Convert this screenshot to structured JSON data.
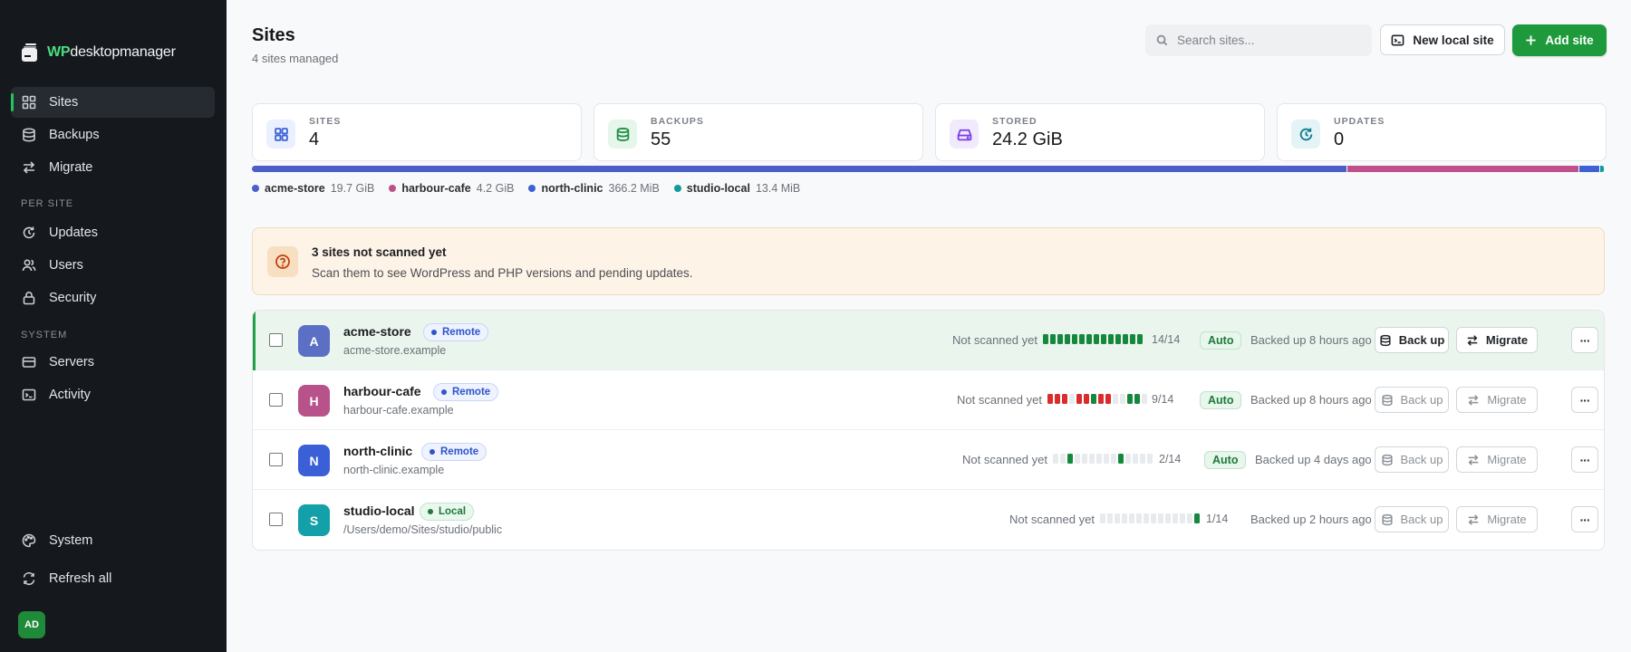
{
  "brand": {
    "prefix": "WP",
    "name": "desktopmanager"
  },
  "sidebar": {
    "items": [
      {
        "label": "Sites",
        "icon": "grid-icon"
      },
      {
        "label": "Backups",
        "icon": "database-icon"
      },
      {
        "label": "Migrate",
        "icon": "arrows-icon"
      }
    ],
    "per_site_label": "PER SITE",
    "per_site": [
      {
        "label": "Updates",
        "icon": "refresh-icon"
      },
      {
        "label": "Users",
        "icon": "users-icon"
      },
      {
        "label": "Security",
        "icon": "lock-icon"
      }
    ],
    "system_label": "SYSTEM",
    "system": [
      {
        "label": "Servers",
        "icon": "server-icon"
      },
      {
        "label": "Activity",
        "icon": "terminal-icon"
      }
    ],
    "footer": [
      {
        "label": "System",
        "icon": "palette-icon"
      },
      {
        "label": "Refresh all",
        "icon": "refresh-icon"
      }
    ],
    "avatar": "AD"
  },
  "header": {
    "title": "Sites",
    "subtitle": "4 sites managed",
    "search_placeholder": "Search sites...",
    "new_local_label": "New local site",
    "add_site_label": "Add site"
  },
  "stats": [
    {
      "label": "SITES",
      "value": "4"
    },
    {
      "label": "BACKUPS",
      "value": "55"
    },
    {
      "label": "STORED",
      "value": "24.2 GiB"
    },
    {
      "label": "UPDATES",
      "value": "0"
    }
  ],
  "storage": [
    {
      "name": "acme-store",
      "size": "19.7 GiB",
      "color": "#4a5fc8",
      "fraction": 0.814
    },
    {
      "name": "harbour-cafe",
      "size": "4.2 GiB",
      "color": "#c0508a",
      "fraction": 0.171
    },
    {
      "name": "north-clinic",
      "size": "366.2 MiB",
      "color": "#3d62d6",
      "fraction": 0.015
    },
    {
      "name": "studio-local",
      "size": "13.4 MiB",
      "color": "#139b9b",
      "fraction": 0.0005
    }
  ],
  "alert": {
    "title": "3 sites not scanned yet",
    "text": "Scan them to see WordPress and PHP versions and pending updates."
  },
  "sites": [
    {
      "name": "acme-store",
      "domain": "acme-store.example",
      "badge": "Remote",
      "initial": "A",
      "color": "#5b6fc4",
      "scan": "Not scanned yet",
      "count": "14/14",
      "auto": "Auto",
      "backed": "Backed up 8 hours ago",
      "backup_label": "Back up",
      "migrate_label": "Migrate",
      "more_label": "···"
    },
    {
      "name": "harbour-cafe",
      "domain": "harbour-cafe.example",
      "badge": "Remote",
      "initial": "H",
      "color": "#b8528a",
      "scan": "Not scanned yet",
      "count": "9/14",
      "auto": "Auto",
      "backed": "Backed up 8 hours ago",
      "backup_label": "Back up",
      "migrate_label": "Migrate",
      "more_label": "···"
    },
    {
      "name": "north-clinic",
      "domain": "north-clinic.example",
      "badge": "Remote",
      "initial": "N",
      "color": "#3b5fd6",
      "scan": "Not scanned yet",
      "count": "2/14",
      "auto": "Auto",
      "backed": "Backed up 4 days ago",
      "backup_label": "Back up",
      "migrate_label": "Migrate",
      "more_label": "···"
    },
    {
      "name": "studio-local",
      "domain": "/Users/demo/Sites/studio/public",
      "badge": "Local",
      "initial": "S",
      "color": "#14a0a8",
      "scan": "Not scanned yet",
      "count": "1/14",
      "auto": "",
      "backed": "Backed up 2 hours ago",
      "backup_label": "Back up",
      "migrate_label": "Migrate",
      "more_label": "···"
    }
  ],
  "colors": {
    "accent": "#1e9a3c",
    "ok": "#16883e",
    "fail": "#d92d2d",
    "empty": "#e8ebee"
  }
}
